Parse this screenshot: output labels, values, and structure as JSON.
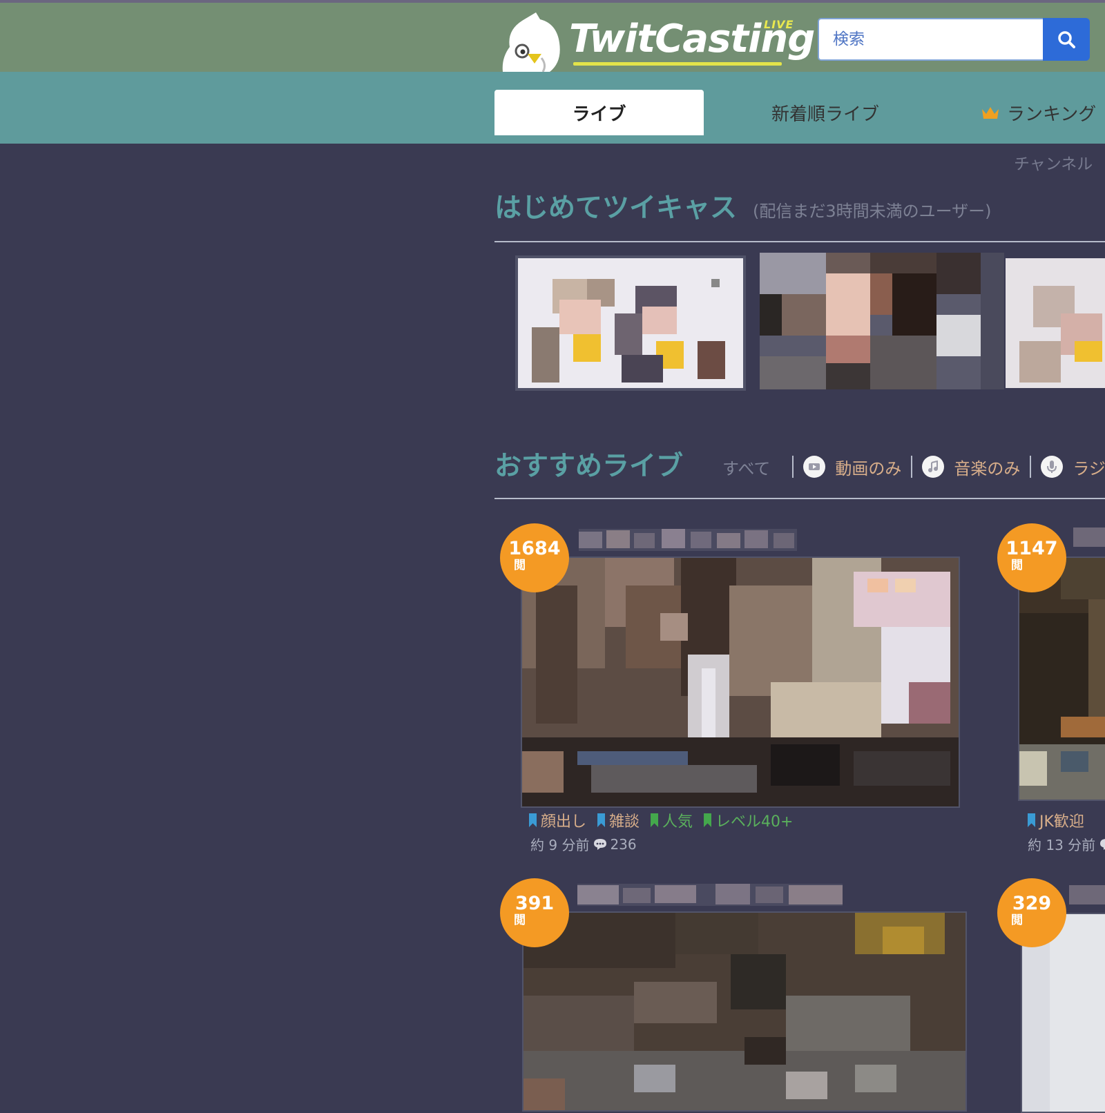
{
  "header": {
    "logo_text": "TwitCasting",
    "logo_badge": "LIVE",
    "search_placeholder": "検索"
  },
  "nav": {
    "tabs": [
      {
        "label": "ライブ",
        "active": true
      },
      {
        "label": "新着順ライブ",
        "active": false
      },
      {
        "label": "ランキング",
        "active": false,
        "icon": "crown-icon"
      }
    ],
    "channel_link": "チャンネル"
  },
  "hajimete": {
    "title": "はじめてツイキャス",
    "subtitle": "(配信まだ3時間未満のユーザー)"
  },
  "osusume": {
    "title": "おすすめライブ",
    "filters": [
      {
        "label": "すべて",
        "icon": ""
      },
      {
        "label": "動画のみ",
        "icon": "video-icon"
      },
      {
        "label": "音楽のみ",
        "icon": "music-note-icon"
      },
      {
        "label": "ラジ",
        "icon": "microphone-icon"
      }
    ]
  },
  "cards": [
    {
      "viewers": "1684",
      "viewer_unit": "閲",
      "tags": [
        {
          "label": "顔出し",
          "color": "#3a9bd5"
        },
        {
          "label": "雑談",
          "color": "#3a9bd5"
        },
        {
          "label": "人気",
          "color": "#44a84c"
        },
        {
          "label": "レベル40+",
          "color": "#44a84c"
        }
      ],
      "time": "約 9 分前",
      "comments": "236"
    },
    {
      "viewers": "1147",
      "viewer_unit": "閲",
      "tags": [
        {
          "label": "JK歓迎",
          "color": "#3a9bd5"
        }
      ],
      "time": "約 13 分前",
      "comments": ""
    },
    {
      "viewers": "391",
      "viewer_unit": "閲",
      "tags": [],
      "time": "",
      "comments": ""
    },
    {
      "viewers": "329",
      "viewer_unit": "閲",
      "tags": [],
      "time": "",
      "comments": ""
    }
  ],
  "colors": {
    "header_bg": "#748f73",
    "nav_bg": "#5f9b9c",
    "page_bg": "#3a3a52",
    "accent_teal": "#5aa0a4",
    "badge_orange": "#f49a24",
    "search_blue": "#2d6bd8"
  }
}
